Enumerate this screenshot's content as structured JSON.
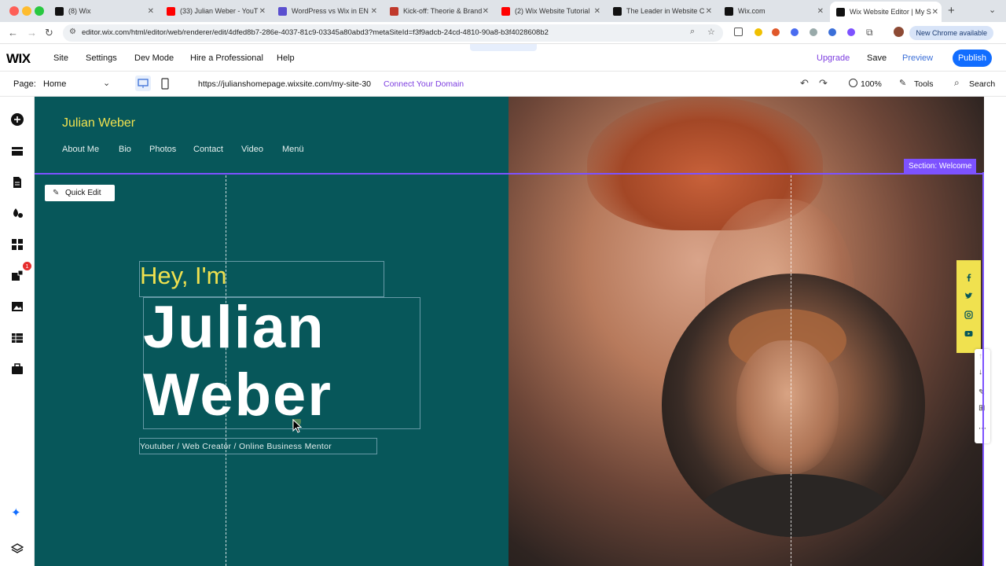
{
  "browser": {
    "tabs": [
      {
        "title": "(8) Wix",
        "favicon_color": "#111111"
      },
      {
        "title": "(33) Julian Weber - YouT",
        "favicon_color": "#ff0000"
      },
      {
        "title": "WordPress vs Wix in EN",
        "favicon_color": "#5a4fcf"
      },
      {
        "title": "Kick-off: Theorie & Brand",
        "favicon_color": "#c0392b"
      },
      {
        "title": "(2) Wix Website Tutorial",
        "favicon_color": "#ff0000"
      },
      {
        "title": "The Leader in Website C",
        "favicon_color": "#111111"
      },
      {
        "title": "Wix.com",
        "favicon_color": "#111111"
      },
      {
        "title": "Wix Website Editor | My S",
        "favicon_color": "#111111"
      }
    ],
    "url": "editor.wix.com/html/editor/web/renderer/edit/4dfed8b7-286e-4037-81c9-03345a80abd3?metaSiteId=f3f9adcb-24cd-4810-90a8-b3f4028608b2",
    "new_chrome_label": "New Chrome available"
  },
  "editor": {
    "logo": "WIX",
    "menu": [
      "Site",
      "Settings",
      "Dev Mode",
      "Hire a Professional",
      "Help"
    ],
    "upgrade_label": "Upgrade",
    "save_label": "Save",
    "preview_label": "Preview",
    "publish_label": "Publish",
    "page_label": "Page:",
    "page_name": "Home",
    "site_url": "https://julianshomepage.wixsite.com/my-site-30",
    "connect_domain_label": "Connect Your Domain",
    "zoom": "100%",
    "tools_label": "Tools",
    "search_label": "Search",
    "left_badge_count": "1",
    "accent_color": "#116dff",
    "section_color": "#7d52ff"
  },
  "site": {
    "name": "Julian Weber",
    "nav": [
      "About Me",
      "Bio",
      "Photos",
      "Contact",
      "Video",
      "Menü"
    ],
    "section_label": "Section: Welcome",
    "quick_edit_label": "Quick Edit",
    "greeting": "Hey, I'm",
    "first_name": "Julian",
    "last_name": "Weber",
    "tagline": "Youtuber / Web Creator / Online Business Mentor",
    "background_color": "#07575a",
    "highlight_color": "#f0e14f",
    "social_icons": [
      "facebook-icon",
      "twitter-icon",
      "instagram-icon",
      "youtube-icon"
    ]
  }
}
